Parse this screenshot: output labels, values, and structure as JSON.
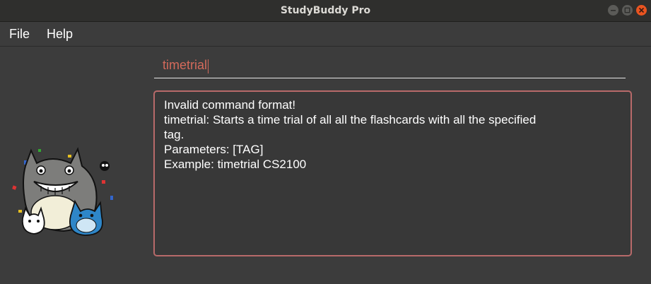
{
  "window": {
    "title": "StudyBuddy Pro"
  },
  "menu": {
    "items": [
      "File",
      "Help"
    ]
  },
  "command_box": {
    "value": "timetrial"
  },
  "result_display": {
    "lines": [
      "Invalid command format!",
      "timetrial: Starts a time trial of all all the flashcards with all the specified",
      "tag.",
      "Parameters: [TAG]",
      "Example: timetrial CS2100"
    ]
  },
  "colors": {
    "window_bg": "#3c3c3c",
    "input_text": "#d46a5b",
    "result_border": "#b86a6a",
    "close_button": "#e95420"
  },
  "icons": [
    "minimize-icon",
    "maximize-icon",
    "close-icon",
    "mascot-image"
  ]
}
